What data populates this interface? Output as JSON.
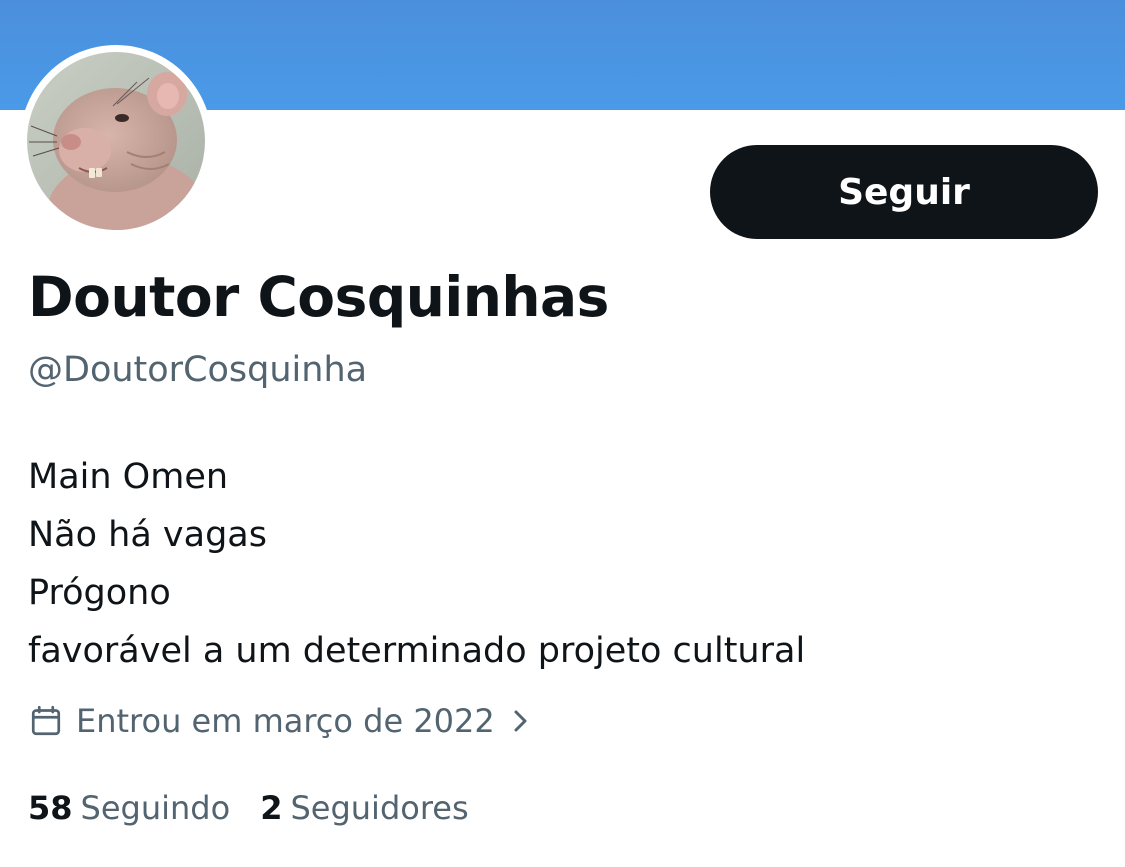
{
  "profile": {
    "display_name": "Doutor Cosquinhas",
    "handle": "@DoutorCosquinha",
    "follow_label": "Seguir",
    "bio_lines": [
      "Main Omen",
      "Não há vagas",
      "Prógono",
      "favorável a um determinado projeto cultural"
    ],
    "joined": "Entrou em março de 2022",
    "joined_icon": "calendar-icon",
    "joined_chevron_icon": "chevron-right-icon",
    "avatar_icon": "hairless-rat-photo",
    "stats": {
      "following_count": "58",
      "following_label": "Seguindo",
      "followers_count": "2",
      "followers_label": "Seguidores"
    }
  },
  "colors": {
    "banner_top": "#4b8fdc",
    "banner_bottom": "#4a9ae8",
    "text_primary": "#0f1419",
    "text_secondary": "#536471",
    "button_bg": "#0f1419",
    "button_text": "#ffffff"
  }
}
